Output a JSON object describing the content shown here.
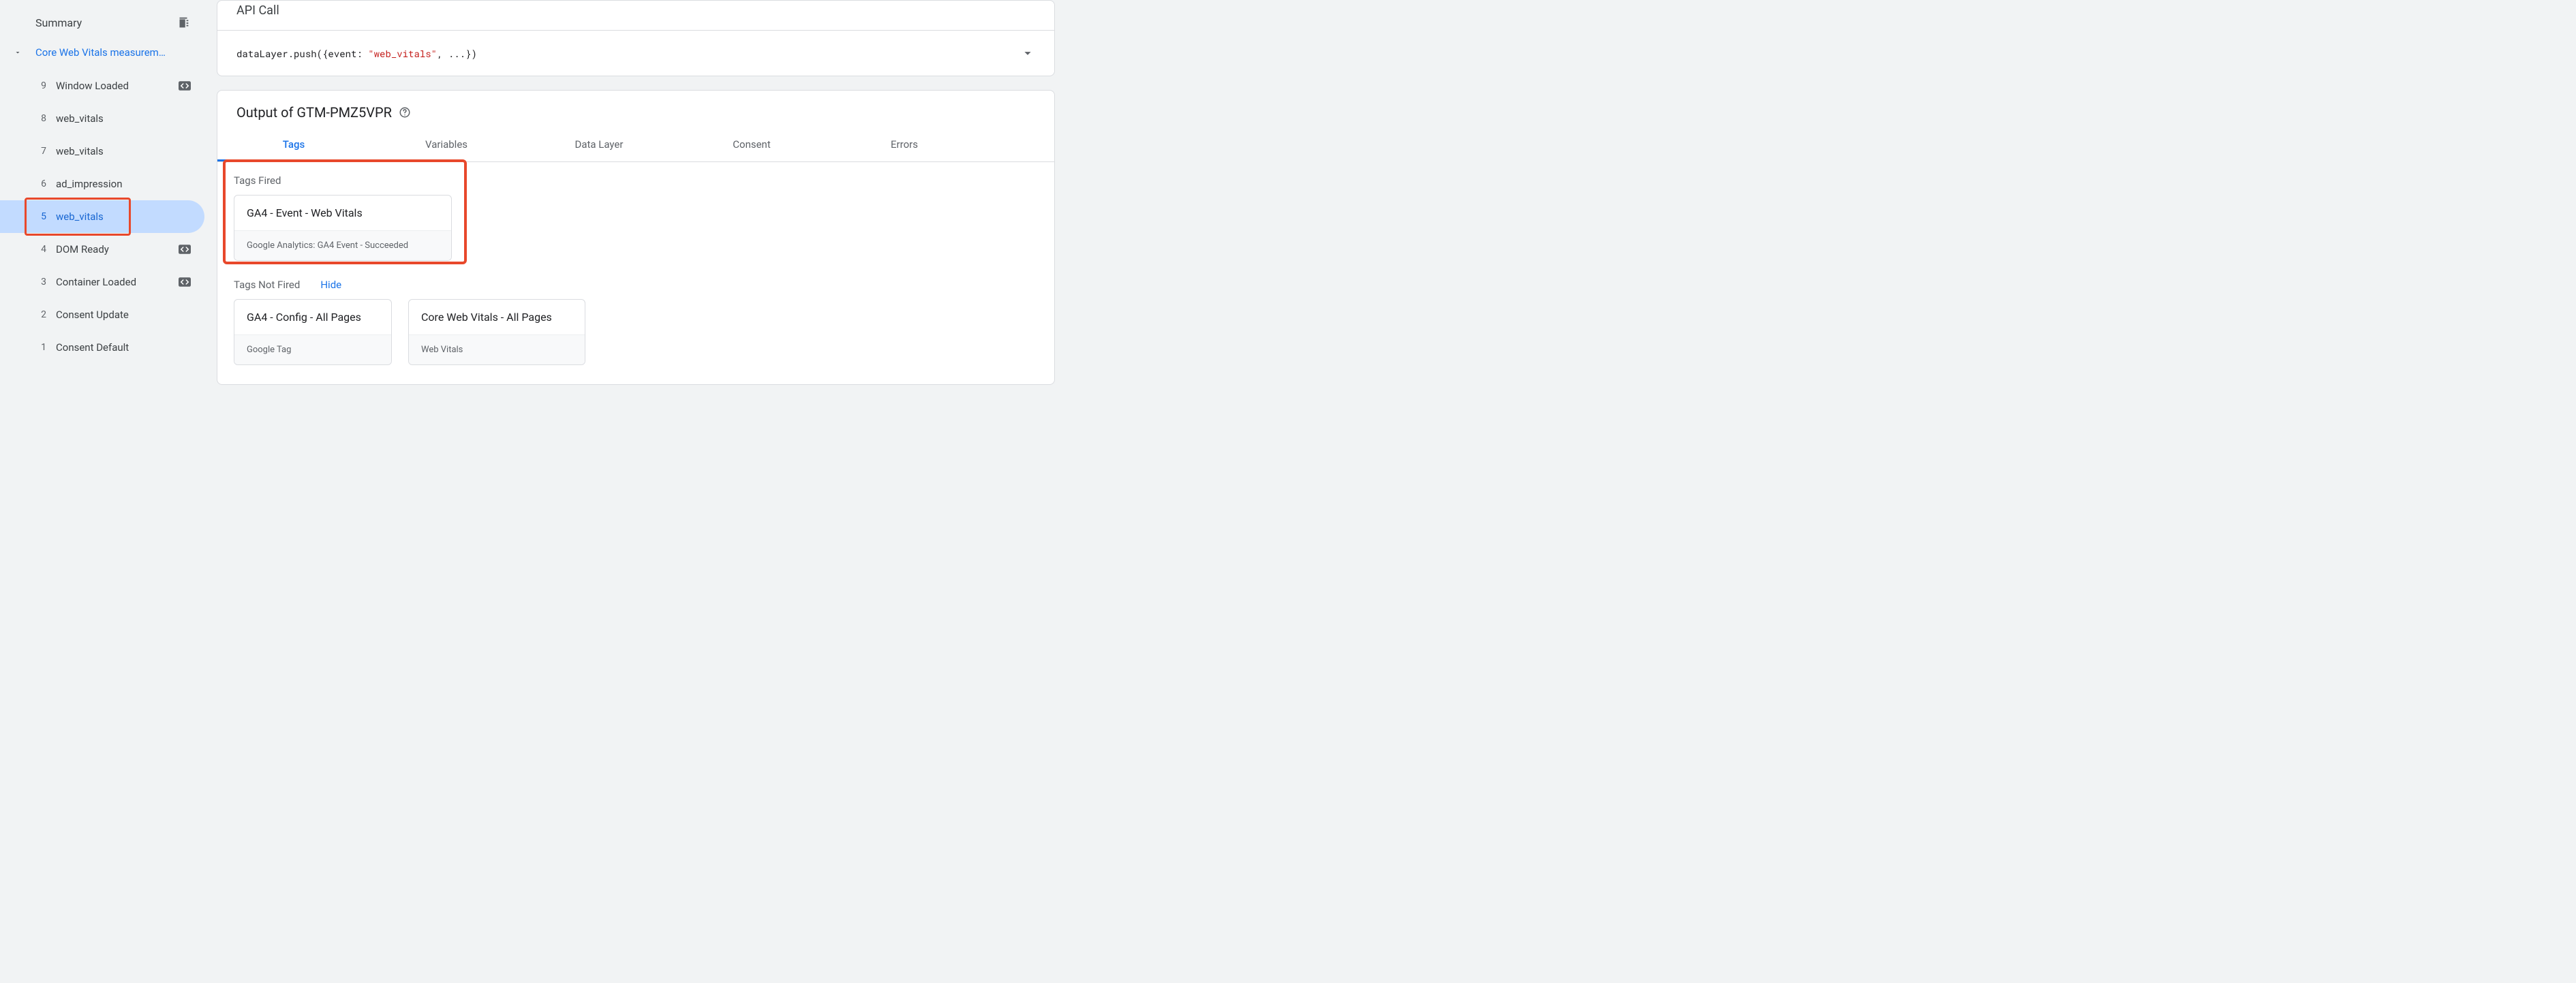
{
  "sidebar": {
    "summary_label": "Summary",
    "group_label": "Core Web Vitals measurem…",
    "events": [
      {
        "num": "9",
        "label": "Window Loaded",
        "badge": true
      },
      {
        "num": "8",
        "label": "web_vitals",
        "badge": false
      },
      {
        "num": "7",
        "label": "web_vitals",
        "badge": false
      },
      {
        "num": "6",
        "label": "ad_impression",
        "badge": false
      },
      {
        "num": "5",
        "label": "web_vitals",
        "badge": false,
        "selected": true
      },
      {
        "num": "4",
        "label": "DOM Ready",
        "badge": true
      },
      {
        "num": "3",
        "label": "Container Loaded",
        "badge": true
      },
      {
        "num": "2",
        "label": "Consent Update",
        "badge": false
      },
      {
        "num": "1",
        "label": "Consent Default",
        "badge": false
      }
    ]
  },
  "api": {
    "title": "API Call",
    "code_pre": "dataLayer.push({event: ",
    "code_str": "\"web_vitals\"",
    "code_post": ", ...})"
  },
  "output": {
    "title": "Output of GTM-PMZ5VPR",
    "tabs": [
      "Tags",
      "Variables",
      "Data Layer",
      "Consent",
      "Errors"
    ],
    "active_tab": 0,
    "fired_title": "Tags Fired",
    "notfired_title": "Tags Not Fired",
    "hide_label": "Hide",
    "fired": [
      {
        "name": "GA4 - Event - Web Vitals",
        "detail": "Google Analytics: GA4 Event - Succeeded"
      }
    ],
    "not_fired": [
      {
        "name": "GA4 - Config - All Pages",
        "detail": "Google Tag"
      },
      {
        "name": "Core Web Vitals - All Pages",
        "detail": "Web Vitals"
      }
    ]
  }
}
